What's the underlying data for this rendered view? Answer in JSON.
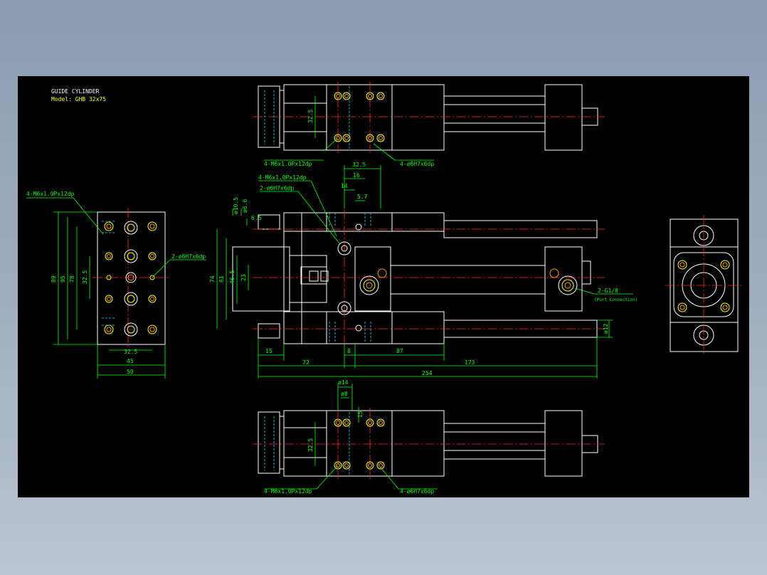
{
  "title_block": {
    "title": "GUIDE CYLINDER",
    "model": "Model: GHB 32x75"
  },
  "callouts": {
    "top_tap": "4-M6x1.0Px12dp",
    "top_pin": "4-ø6H7x6dp",
    "left_tap": "4-M6x1.0Px12dp",
    "left_pin": "2-ø6H7x6dp",
    "front_tap": "4-M6x1.0Px12dp",
    "front_pin": "2-ø6H7x6dp",
    "port": "2-G1/8",
    "port_note": "(Port Connection)",
    "bottom_tap": "4-M6x1.0Px12dp",
    "bottom_pin": "4-ø6H7x6dp"
  },
  "dims": {
    "top_325": "32.5",
    "left_89": "89",
    "left_95": "95",
    "left_78": "78",
    "left_325": "32.5",
    "left_b325": "32.5",
    "left_45": "45",
    "left_50": "50",
    "f_325": "32.5",
    "f_16": "16",
    "f_14": "14",
    "f_57": "5.7",
    "f_105": "ø10.5",
    "f_66": "ø6.6",
    "f_65": "6.5",
    "f_74": "74",
    "f_61": "61",
    "f_465": "46.5",
    "f_23": "23",
    "f_15": "15",
    "f_8": "8",
    "f_87": "87",
    "f_72": "72",
    "f_173": "173",
    "f_254": "254",
    "f_d12": "ø12",
    "b_d14": "ø14",
    "b_d8": "ø8",
    "b_15": "15",
    "b_325": "32.5"
  }
}
